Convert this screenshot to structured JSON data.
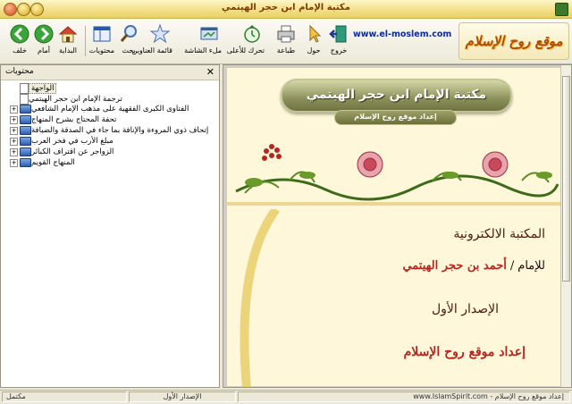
{
  "window": {
    "title": "مكتبة الإمام ابن حجر الهيتمي"
  },
  "toolbar": {
    "buttons": [
      {
        "label": "خلف",
        "icon": "back-arrow-icon"
      },
      {
        "label": "أمام",
        "icon": "forward-arrow-icon"
      },
      {
        "label": "البداية",
        "icon": "home-icon"
      },
      {
        "label": "محتويات",
        "icon": "contents-icon"
      },
      {
        "label": "بحث",
        "icon": "search-icon"
      },
      {
        "label": "قائمة العناوين",
        "icon": "star-icon"
      },
      {
        "label": "ملء الشاشة",
        "icon": "fullscreen-icon"
      },
      {
        "label": "تحرك للأعلى",
        "icon": "clock-up-icon"
      },
      {
        "label": "طباعة",
        "icon": "printer-icon"
      },
      {
        "label": "حول",
        "icon": "pointer-icon"
      },
      {
        "label": "خروج",
        "icon": "exit-icon"
      }
    ],
    "url": "www.el-moslem.com",
    "logo_text": "موقع روح الإسلام"
  },
  "sidebar": {
    "title": "محتويات",
    "close": "✕",
    "items": [
      {
        "label": "الواجهة",
        "type": "page",
        "expandable": false,
        "selected": true,
        "indent": 1
      },
      {
        "label": "ترجمة الإمام ابن حجر الهيتمي",
        "type": "page",
        "expandable": false,
        "selected": false,
        "indent": 1
      },
      {
        "label": "الفتاوى الكبرى الفقهية على مذهب الإمام الشافعي",
        "type": "book",
        "expandable": true,
        "selected": false,
        "indent": 0
      },
      {
        "label": "تحفة المحتاج بشرح المنهاج",
        "type": "book",
        "expandable": true,
        "selected": false,
        "indent": 0
      },
      {
        "label": "إتحاف ذوي المروءة والإنافة بما جاء في الصدقة والضيافة",
        "type": "book",
        "expandable": true,
        "selected": false,
        "indent": 0
      },
      {
        "label": "مبلغ الأرب في فخر العرب",
        "type": "book",
        "expandable": true,
        "selected": false,
        "indent": 0
      },
      {
        "label": "الزواجر عن اقتراف الكبائر",
        "type": "book",
        "expandable": true,
        "selected": false,
        "indent": 0
      },
      {
        "label": "المنهاج القويم",
        "type": "book",
        "expandable": true,
        "selected": false,
        "indent": 0
      }
    ]
  },
  "content": {
    "banner_title": "مكتبة الإمام ابن حجر الهيتمي",
    "banner_sub": "إعداد موقع روح الإسلام",
    "library_label": "المكتبة الالكترونية",
    "author_prefix": "للإمام",
    "author_sep": "/",
    "author_name": "أحمد بن حجر الهيتمي",
    "edition": "الإصدار الأول",
    "prepared_by": "إعداد موقع روح الإسلام"
  },
  "statusbar": {
    "left": "مكتمل",
    "middle": "الإصدار الأول",
    "right": "إعداد موقع روح الإسلام - www.IslamSpirit.com"
  },
  "colors": {
    "title_text": "#7a3d00",
    "accent_red": "#b3281e",
    "banner_green": "#8c915b",
    "page_bg": "#fff7da"
  }
}
